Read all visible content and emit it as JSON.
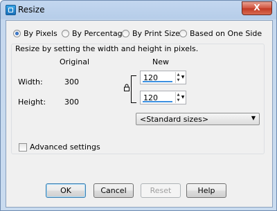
{
  "window": {
    "title": "Resize",
    "close_label": "X"
  },
  "modes": [
    {
      "label": "By Pixels",
      "selected": true
    },
    {
      "label": "By Percentage",
      "selected": false
    },
    {
      "label": "By Print Size",
      "selected": false
    },
    {
      "label": "Based on One Side",
      "selected": false
    }
  ],
  "group": {
    "caption": "Resize by setting the width and height in pixels.",
    "col_original": "Original",
    "col_new": "New"
  },
  "width": {
    "label": "Width:",
    "original": "300",
    "new": "120"
  },
  "height": {
    "label": "Height:",
    "original": "300",
    "new": "120"
  },
  "standard_sizes": "<Standard sizes>",
  "advanced": {
    "label": "Advanced settings",
    "checked": false
  },
  "buttons": {
    "ok": "OK",
    "cancel": "Cancel",
    "reset": "Reset",
    "help": "Help"
  }
}
